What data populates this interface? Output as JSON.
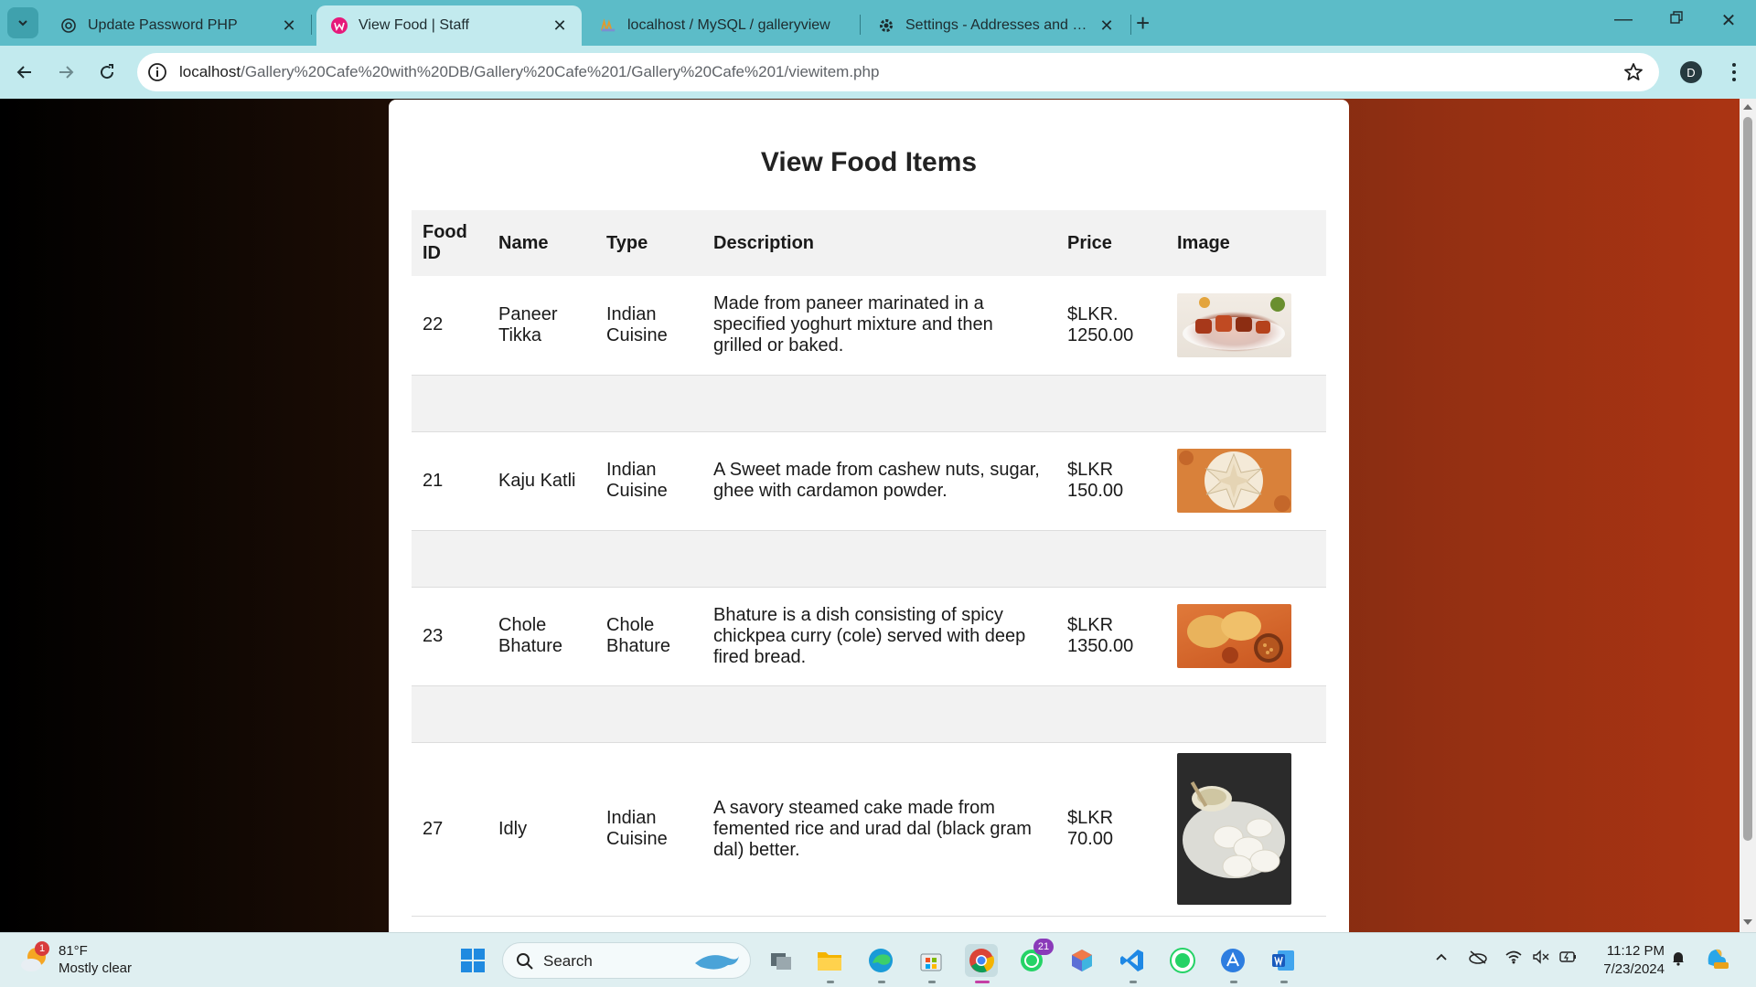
{
  "browser": {
    "tabs": [
      {
        "title": "Update Password PHP",
        "icon": "openai-icon",
        "active": false
      },
      {
        "title": "View Food | Staff",
        "icon": "wamp-icon",
        "active": true
      },
      {
        "title": "localhost / MySQL / galleryview",
        "icon": "phpmyadmin-icon",
        "active": false
      },
      {
        "title": "Settings - Addresses and more",
        "icon": "gear-icon",
        "active": false
      }
    ],
    "new_tab_label": "+",
    "url_host": "localhost",
    "url_path": "/Gallery%20Cafe%20with%20DB/Gallery%20Cafe%201/Gallery%20Cafe%201/viewitem.php",
    "profile_initial": "D"
  },
  "page": {
    "title": "View Food Items",
    "columns": [
      "Food ID",
      "Name",
      "Type",
      "Description",
      "Price",
      "Image"
    ],
    "items": [
      {
        "id": "22",
        "name": "Paneer Tikka",
        "type": "Indian Cuisine",
        "description": "Made from paneer marinated in a specified yoghurt mixture and then grilled or baked.",
        "price": "$LKR. 1250.00",
        "image": "paneer-tikka-photo"
      },
      {
        "id": "21",
        "name": "Kaju Katli",
        "type": "Indian Cuisine",
        "description": "A Sweet made from cashew nuts, sugar, ghee with cardamon powder.",
        "price": "$LKR 150.00",
        "image": "kaju-katli-photo"
      },
      {
        "id": "23",
        "name": "Chole Bhature",
        "type": "Chole Bhature",
        "description": "Bhature is a dish consisting of spicy chickpea curry (cole) served with deep fired bread.",
        "price": "$LKR 1350.00",
        "image": "chole-bhature-photo"
      },
      {
        "id": "27",
        "name": "Idly",
        "type": "Indian Cuisine",
        "description": "A savory steamed cake made from femented rice and urad dal (black gram dal) better.",
        "price": "$LKR 70.00",
        "image": "idly-photo"
      }
    ]
  },
  "taskbar": {
    "weather_temp": "81°F",
    "weather_desc": "Mostly clear",
    "weather_badge": "1",
    "search_label": "Search",
    "whatsapp_badge": "21",
    "time": "11:12 PM",
    "date": "7/23/2024"
  },
  "colors": {
    "tabstrip": "#5cbcc8",
    "toolbar": "#c2eaee",
    "page_gradient_start": "#000000",
    "page_gradient_end": "#ab3413",
    "table_header_bg": "#f2f2f2"
  }
}
